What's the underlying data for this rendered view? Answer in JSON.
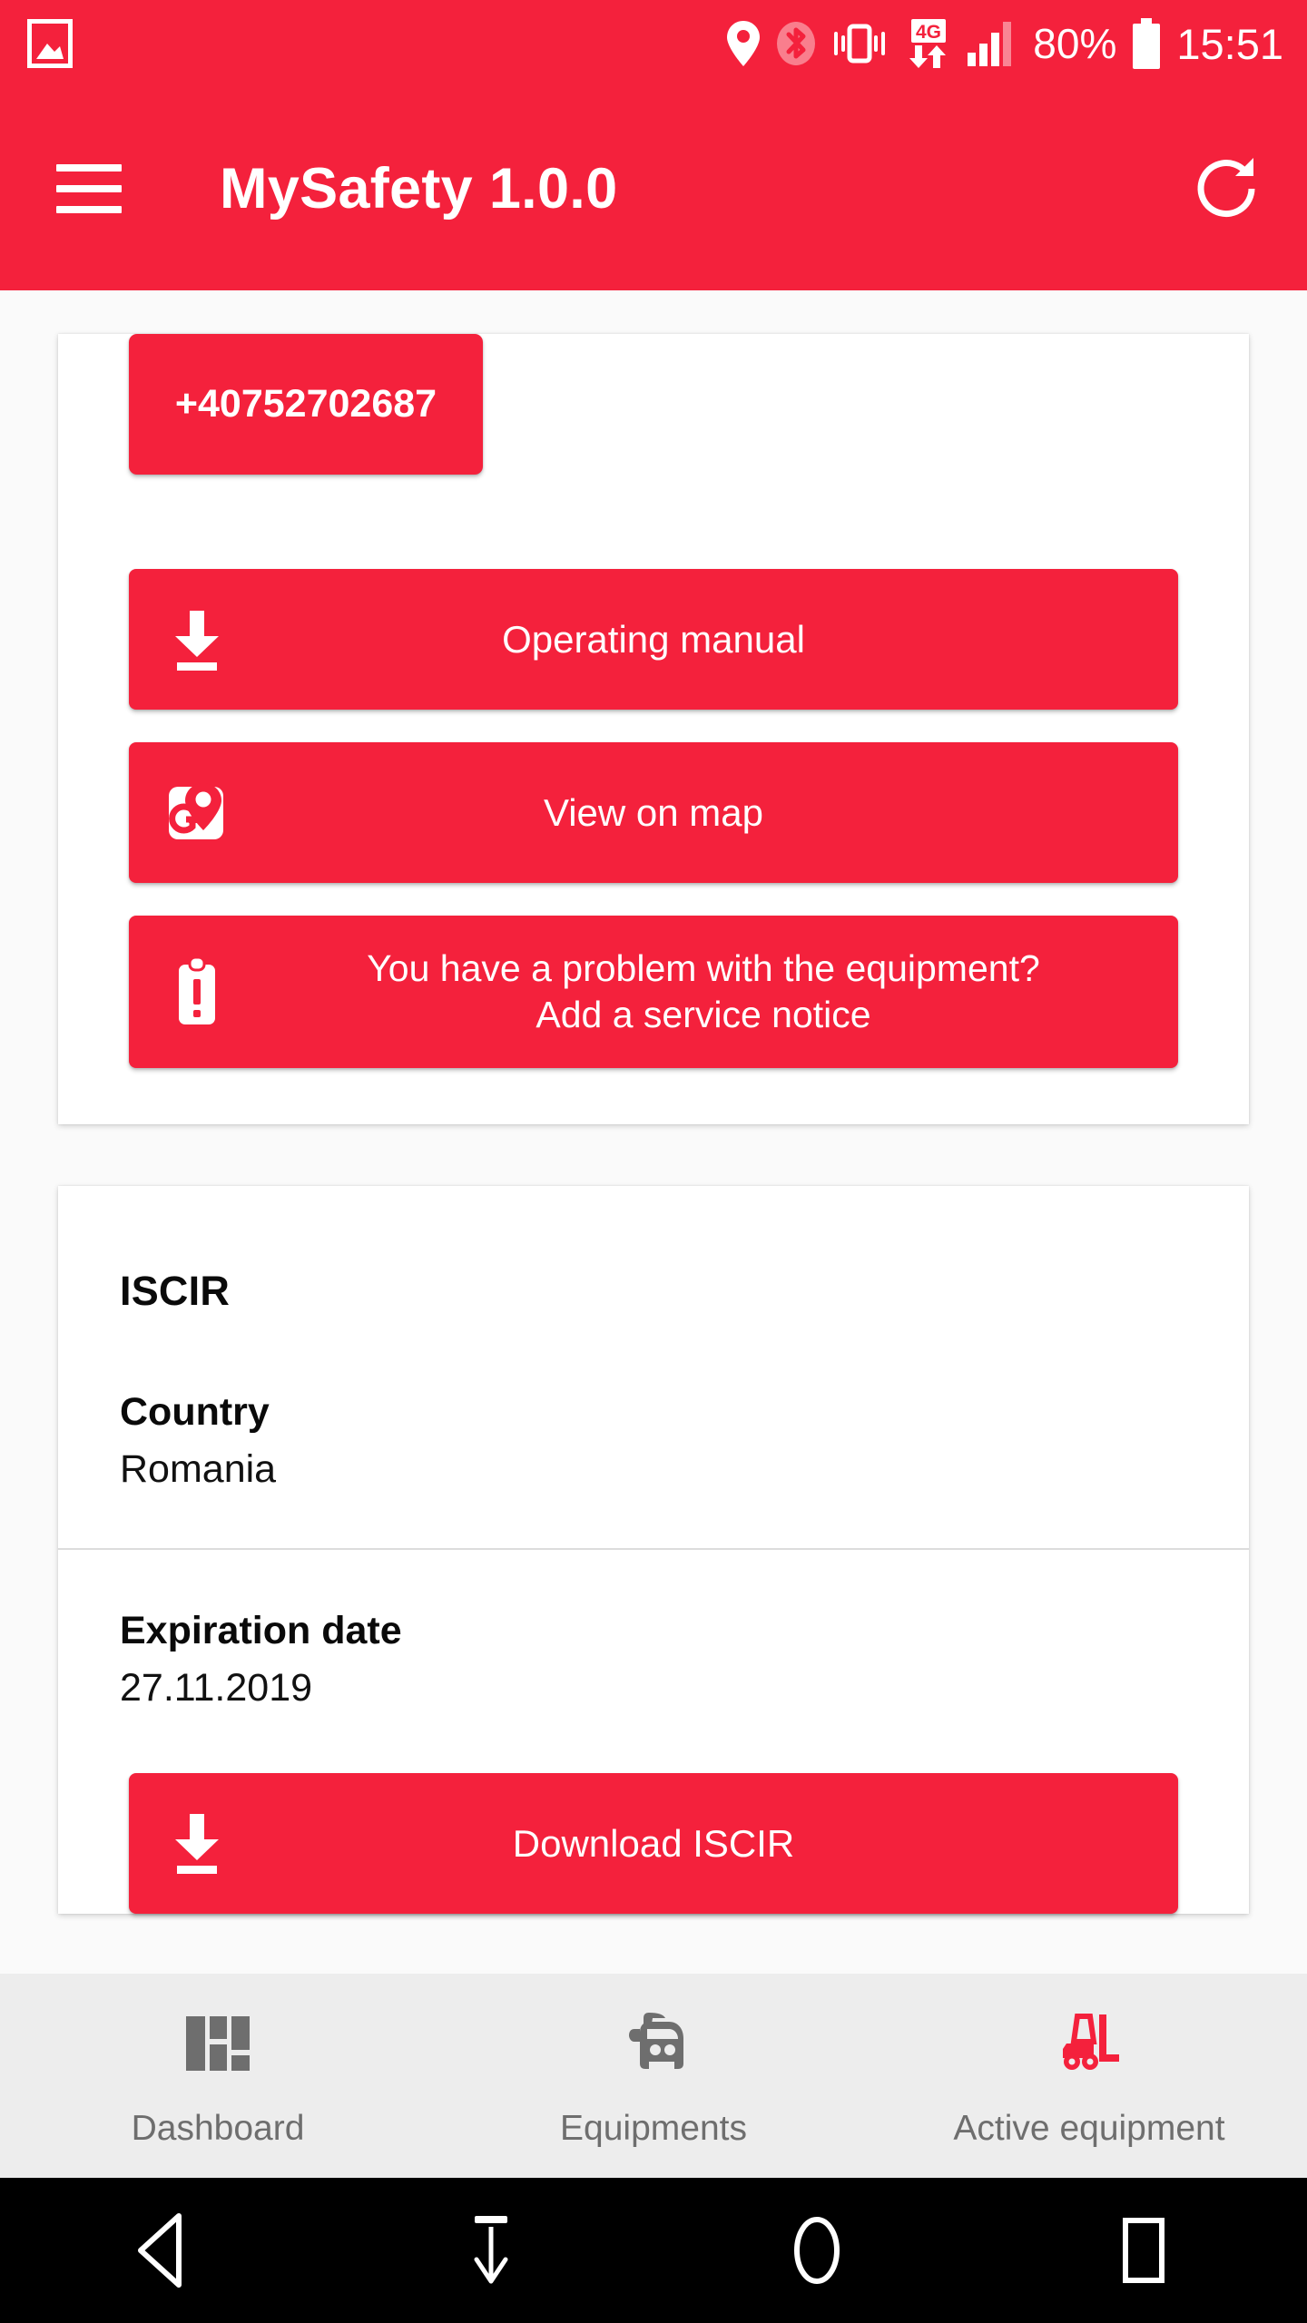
{
  "status_bar": {
    "icons": [
      "image-icon",
      "location-pin-icon",
      "bluetooth-icon",
      "vibrate-icon",
      "4g-data-icon",
      "signal-bars-icon"
    ],
    "network_label": "4G",
    "battery_percent": "80%",
    "clock": "15:51"
  },
  "app_bar": {
    "menu_icon": "hamburger-menu-icon",
    "title": "MySafety 1.0.0",
    "refresh_icon": "refresh-icon"
  },
  "equipment_card": {
    "phone_button": {
      "label": "+40752702687"
    },
    "operating_manual_button": {
      "label": "Operating manual",
      "icon": "download-icon"
    },
    "view_on_map_button": {
      "label": "View on map",
      "icon": "google-maps-icon"
    },
    "service_notice_button": {
      "line1": "You have a problem with the equipment?",
      "line2": "Add a service notice",
      "icon": "clipboard-alert-icon"
    }
  },
  "iscir_card": {
    "title": "ISCIR",
    "fields": [
      {
        "label": "Country",
        "value": "Romania"
      },
      {
        "label": "Expiration date",
        "value": "27.11.2019"
      }
    ],
    "download_button": {
      "label": "Download ISCIR",
      "icon": "download-icon"
    }
  },
  "bottom_nav": {
    "tabs": [
      {
        "label": "Dashboard",
        "icon": "dashboard-grid-icon",
        "active": false
      },
      {
        "label": "Equipments",
        "icon": "vehicle-icon",
        "active": false
      },
      {
        "label": "Active equipment",
        "icon": "forklift-icon",
        "active": true
      }
    ]
  },
  "android_nav": {
    "keys": [
      "back-icon",
      "hide-keyboard-icon",
      "home-icon",
      "recents-icon"
    ]
  },
  "colors": {
    "brand_red": "#F4213C",
    "page_background": "#FAFAFA",
    "card_background": "#FFFFFF",
    "nav_background": "#EDEDED",
    "nav_inactive": "#6E6E6E",
    "nav_active": "#F4213C",
    "text_primary": "#0A0A0A"
  }
}
